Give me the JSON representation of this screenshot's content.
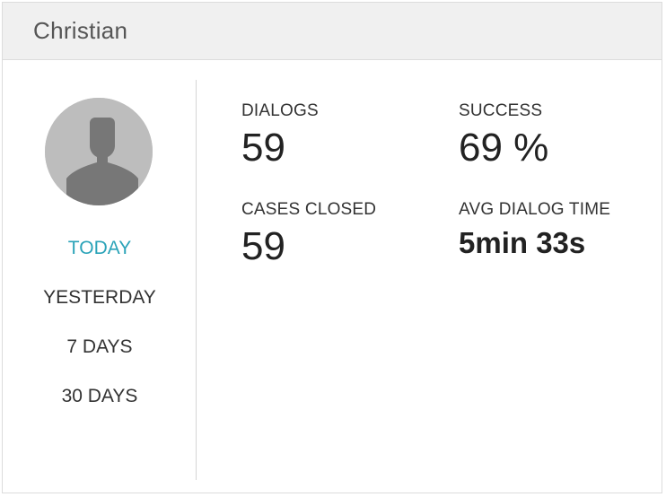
{
  "card": {
    "title": "Christian"
  },
  "sidebar": {
    "avatar_icon": "user-silhouette-icon",
    "periods": [
      {
        "label": "TODAY",
        "active": true
      },
      {
        "label": "YESTERDAY",
        "active": false
      },
      {
        "label": "7 DAYS",
        "active": false
      },
      {
        "label": "30 DAYS",
        "active": false
      }
    ]
  },
  "stats": {
    "dialogs": {
      "label": "DIALOGS",
      "value": "59"
    },
    "success": {
      "label": "SUCCESS",
      "value": "69 %"
    },
    "cases_closed": {
      "label": "CASES CLOSED",
      "value": "59"
    },
    "avg_dialog_time": {
      "label": "AVG DIALOG TIME",
      "value": "5min 33s"
    }
  },
  "colors": {
    "accent": "#2aa3b8",
    "header_bg": "#f0f0f0",
    "avatar_bg": "#bdbdbd",
    "avatar_silhouette": "#777777"
  }
}
